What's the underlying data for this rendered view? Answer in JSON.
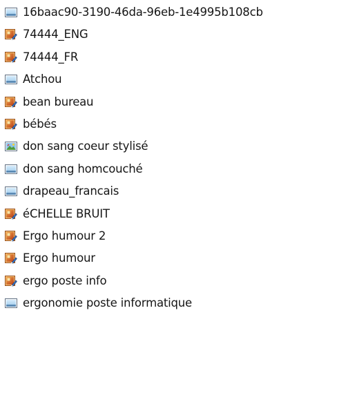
{
  "files": [
    {
      "name": "16baac90-3190-46da-96eb-1e4995b108cb",
      "icon": "bitmap-image-icon"
    },
    {
      "name": "74444_ENG",
      "icon": "paint-image-icon"
    },
    {
      "name": "74444_FR",
      "icon": "paint-image-icon"
    },
    {
      "name": "Atchou",
      "icon": "bitmap-image-icon"
    },
    {
      "name": "bean bureau",
      "icon": "paint-image-icon"
    },
    {
      "name": "bébés",
      "icon": "paint-image-icon"
    },
    {
      "name": "don sang coeur stylisé",
      "icon": "landscape-image-icon"
    },
    {
      "name": "don sang homcouché",
      "icon": "bitmap-image-icon"
    },
    {
      "name": "drapeau_francais",
      "icon": "bitmap-image-icon"
    },
    {
      "name": "éCHELLE BRUIT",
      "icon": "paint-image-icon"
    },
    {
      "name": "Ergo humour 2",
      "icon": "paint-image-icon"
    },
    {
      "name": "Ergo humour",
      "icon": "paint-image-icon"
    },
    {
      "name": "ergo poste info",
      "icon": "paint-image-icon"
    },
    {
      "name": "ergonomie poste informatique",
      "icon": "bitmap-image-icon"
    }
  ]
}
